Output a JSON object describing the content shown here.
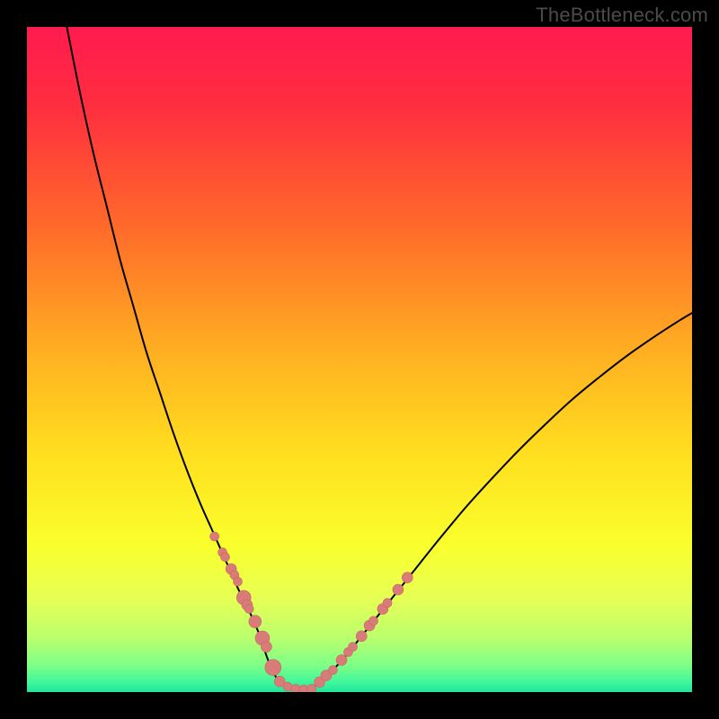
{
  "watermark": "TheBottleneck.com",
  "colors": {
    "frame": "#000000",
    "gradient_stops": [
      {
        "offset": 0.0,
        "color": "#ff1b4f"
      },
      {
        "offset": 0.12,
        "color": "#ff2e3f"
      },
      {
        "offset": 0.3,
        "color": "#ff6a2a"
      },
      {
        "offset": 0.5,
        "color": "#ffb321"
      },
      {
        "offset": 0.65,
        "color": "#ffe11f"
      },
      {
        "offset": 0.78,
        "color": "#faff2c"
      },
      {
        "offset": 0.86,
        "color": "#e6ff55"
      },
      {
        "offset": 0.92,
        "color": "#b9ff6e"
      },
      {
        "offset": 0.96,
        "color": "#7dff87"
      },
      {
        "offset": 0.985,
        "color": "#41f79a"
      },
      {
        "offset": 1.0,
        "color": "#1fe59d"
      }
    ],
    "curve": "#000000",
    "marker_fill": "#d97b78",
    "marker_stroke": "#c96865"
  },
  "chart_data": {
    "type": "line",
    "title": "",
    "xlabel": "",
    "ylabel": "",
    "xlim": [
      0,
      100
    ],
    "ylim": [
      0,
      100
    ],
    "series": [
      {
        "name": "left-branch",
        "x": [
          6,
          8,
          10,
          12,
          14,
          16,
          18,
          20,
          22,
          24,
          26,
          28,
          30,
          32,
          33.5,
          35,
          36,
          37
        ],
        "y": [
          100,
          90,
          81,
          73,
          65,
          58,
          51,
          45,
          39,
          33.5,
          28.5,
          24,
          19.5,
          15,
          12,
          8.5,
          5.5,
          3
        ]
      },
      {
        "name": "valley",
        "x": [
          37,
          38,
          39,
          40,
          41,
          42,
          43,
          44,
          45,
          46
        ],
        "y": [
          3,
          1.6,
          0.9,
          0.55,
          0.4,
          0.5,
          0.8,
          1.4,
          2.3,
          3.3
        ]
      },
      {
        "name": "right-branch",
        "x": [
          46,
          48,
          50,
          52,
          54,
          56,
          58,
          62,
          66,
          70,
          74,
          78,
          82,
          86,
          90,
          94,
          98,
          100
        ],
        "y": [
          3.3,
          5.5,
          8,
          10.5,
          13,
          15.5,
          18,
          23,
          27.8,
          32.2,
          36.4,
          40.3,
          44,
          47.3,
          50.4,
          53.2,
          55.8,
          57
        ]
      }
    ],
    "markers": {
      "name": "highlighted-points",
      "x": [
        28.2,
        29.4,
        29.8,
        30.7,
        31.2,
        31.7,
        32.6,
        33.1,
        33.4,
        34.3,
        35.4,
        36.0,
        37.0,
        38.0,
        39.2,
        40.4,
        41.6,
        42.8,
        44.0,
        45.0,
        46.0,
        47.3,
        48.3,
        49.0,
        50.3,
        51.5,
        52.1,
        53.5,
        54.2,
        55.8,
        57.2
      ],
      "y": [
        23.4,
        21.0,
        20.3,
        18.5,
        17.6,
        16.6,
        14.2,
        13.1,
        12.5,
        10.6,
        8.1,
        6.8,
        3.7,
        1.6,
        0.8,
        0.5,
        0.4,
        0.5,
        1.5,
        2.5,
        3.3,
        4.8,
        6.0,
        6.8,
        8.4,
        10.0,
        10.7,
        12.5,
        13.4,
        15.4,
        17.2
      ],
      "r": [
        5,
        5,
        5,
        6,
        5,
        5,
        8,
        6,
        5,
        7,
        8,
        6,
        9,
        6,
        5,
        5,
        5,
        5,
        6,
        6,
        5,
        6,
        5,
        5,
        6,
        6,
        5,
        6,
        5,
        6,
        6
      ]
    }
  }
}
